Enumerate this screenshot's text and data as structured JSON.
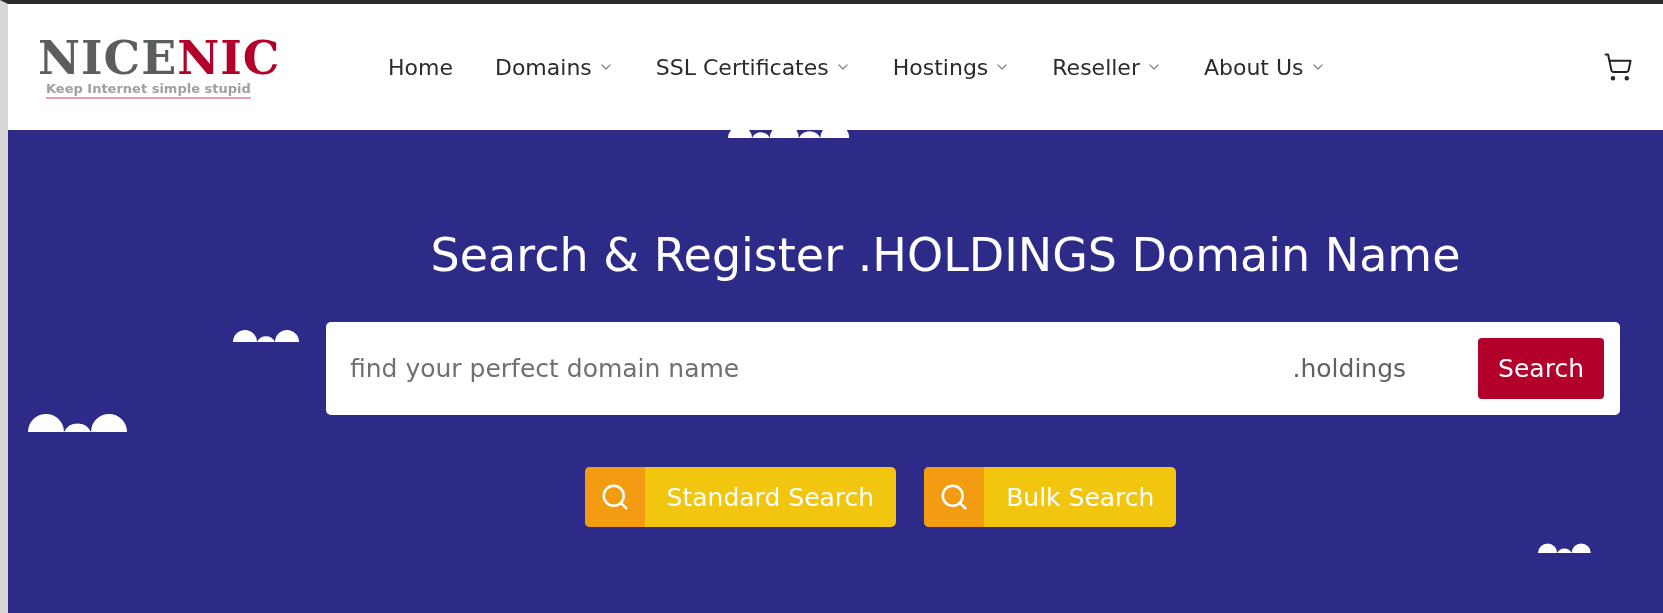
{
  "logo": {
    "first": "NICE",
    "second": "NIC",
    "tagline": "Keep Internet simple stupid"
  },
  "nav": [
    {
      "label": "Home",
      "dropdown": false
    },
    {
      "label": "Domains",
      "dropdown": true
    },
    {
      "label": "SSL Certificates",
      "dropdown": true
    },
    {
      "label": "Hostings",
      "dropdown": true
    },
    {
      "label": "Reseller",
      "dropdown": true
    },
    {
      "label": "About Us",
      "dropdown": true
    }
  ],
  "hero": {
    "title": "Search & Register .HOLDINGS Domain Name",
    "search": {
      "placeholder": "find your perfect domain name",
      "suffix": ".holdings",
      "button": "Search"
    },
    "modes": [
      {
        "label": "Standard Search"
      },
      {
        "label": "Bulk Search"
      }
    ]
  }
}
